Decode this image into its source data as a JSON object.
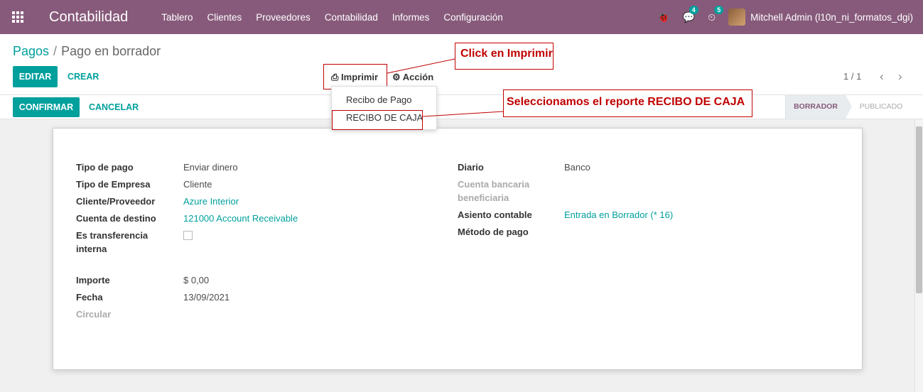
{
  "navbar": {
    "app_name": "Contabilidad",
    "menu": [
      "Tablero",
      "Clientes",
      "Proveedores",
      "Contabilidad",
      "Informes",
      "Configuración"
    ],
    "messages_count": "4",
    "activities_count": "5",
    "user": "Mitchell Admin (l10n_ni_formatos_dgi)",
    "icons": {
      "apps": "apps-grid-icon",
      "debug": "bug-icon",
      "messages": "chat-icon",
      "activities": "clock-icon"
    }
  },
  "breadcrumb": {
    "parent": "Pagos",
    "separator": "/",
    "current": "Pago en borrador"
  },
  "buttons": {
    "edit": "EDITAR",
    "create": "CREAR",
    "print": "Imprimir",
    "action": "Acción",
    "confirm": "CONFIRMAR",
    "cancel": "CANCELAR"
  },
  "pager": {
    "value": "1 / 1"
  },
  "print_menu": [
    "Recibo de Pago",
    "RECIBO DE CAJA"
  ],
  "statusbar": {
    "stages": [
      "BORRADOR",
      "PUBLICADO"
    ],
    "active": "BORRADOR"
  },
  "form": {
    "left": [
      {
        "label": "Tipo de pago",
        "value": "Enviar dinero"
      },
      {
        "label": "Tipo de Empresa",
        "value": "Cliente"
      },
      {
        "label": "Cliente/Proveedor",
        "value": "Azure Interior"
      },
      {
        "label": "Cuenta de destino",
        "value": "121000 Account Receivable"
      },
      {
        "label": "Es transferencia interna",
        "value": ""
      },
      {
        "label": "Importe",
        "value": "$ 0,00"
      },
      {
        "label": "Fecha",
        "value": "13/09/2021"
      },
      {
        "label": "Circular",
        "value": ""
      }
    ],
    "right": [
      {
        "label": "Diario",
        "value": "Banco"
      },
      {
        "label": "Cuenta bancaria beneficiaria",
        "value": ""
      },
      {
        "label": "Asiento contable",
        "value": "Entrada en Borrador (* 16)"
      },
      {
        "label": "Método de pago",
        "value": ""
      }
    ]
  },
  "annotations": {
    "click_print": "Click en Imprimir",
    "select_report": "Seleccionamos el reporte RECIBO DE CAJA"
  },
  "colors": {
    "brand": "#875a7b",
    "accent": "#00a09d",
    "annotation": "#c00000"
  }
}
